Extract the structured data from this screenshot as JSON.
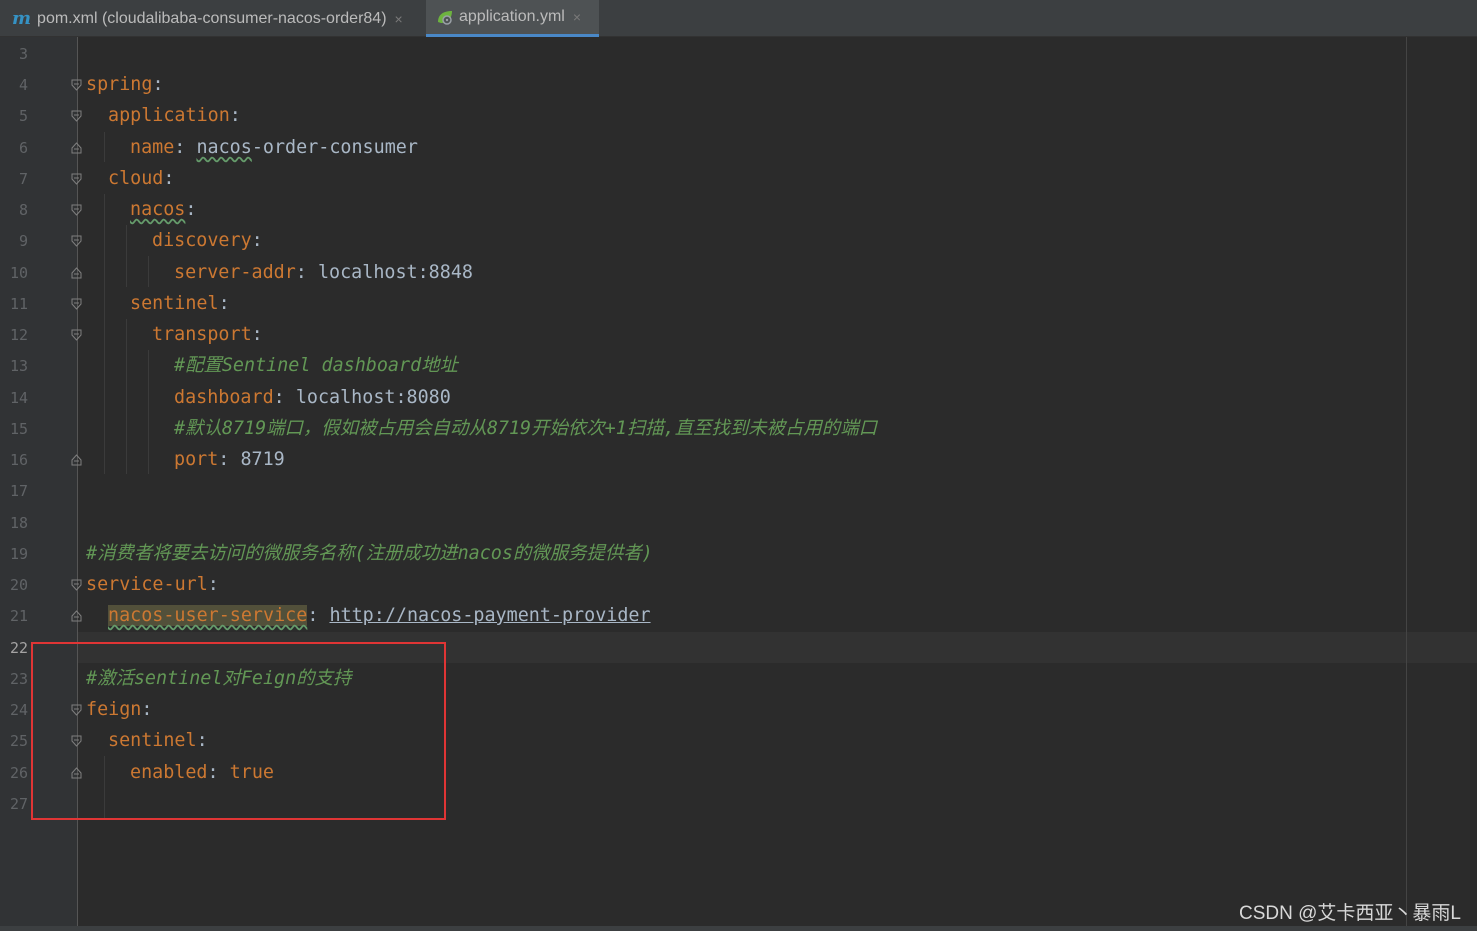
{
  "tabs": [
    {
      "icon": "maven-m-icon",
      "icon_glyph": "m",
      "label": "pom.xml (cloudalibaba-consumer-nacos-order84)",
      "close": "×",
      "active": false
    },
    {
      "icon": "spring-leaf-icon",
      "label": "application.yml",
      "close": "×",
      "active": true
    }
  ],
  "editor": {
    "line_numbers": [
      "3",
      "4",
      "5",
      "6",
      "7",
      "8",
      "9",
      "10",
      "11",
      "12",
      "13",
      "14",
      "15",
      "16",
      "17",
      "18",
      "19",
      "20",
      "21",
      "22",
      "23",
      "24",
      "25",
      "26",
      "27"
    ],
    "current_line": "22",
    "lines": {
      "l4": {
        "key": "spring",
        "colon": ":"
      },
      "l5": {
        "key": "application",
        "colon": ":"
      },
      "l6": {
        "key": "name",
        "colon": ": ",
        "value_a": "nacos",
        "value_b": "-order-consumer"
      },
      "l7": {
        "key": "cloud",
        "colon": ":"
      },
      "l8": {
        "key": "nacos",
        "colon": ":"
      },
      "l9": {
        "key": "discovery",
        "colon": ":"
      },
      "l10": {
        "key": "server-addr",
        "colon": ": ",
        "value": "localhost:8848"
      },
      "l11": {
        "key": "sentinel",
        "colon": ":"
      },
      "l12": {
        "key": "transport",
        "colon": ":"
      },
      "l13": {
        "comment": "#配置Sentinel dashboard地址"
      },
      "l14": {
        "key": "dashboard",
        "colon": ": ",
        "value": "localhost:8080"
      },
      "l15": {
        "comment": "#默认8719端口，假如被占用会自动从8719开始依次+1扫描,直至找到未被占用的端口"
      },
      "l16": {
        "key": "port",
        "colon": ": ",
        "value": "8719"
      },
      "l19": {
        "comment": "#消费者将要去访问的微服务名称(注册成功进nacos的微服务提供者)"
      },
      "l20": {
        "key": "service-url",
        "colon": ":"
      },
      "l21": {
        "key": "nacos-user-service",
        "colon": ": ",
        "value": "http://nacos-payment-provider"
      },
      "l23": {
        "comment": "#激活sentinel对Feign的支持"
      },
      "l24": {
        "key": "feign",
        "colon": ":"
      },
      "l25": {
        "key": "sentinel",
        "colon": ":"
      },
      "l26": {
        "key": "enabled",
        "colon": ": ",
        "value": "true"
      }
    }
  },
  "watermark": "CSDN @艾卡西亚丶暴雨L",
  "colors": {
    "background": "#2b2b2b",
    "gutter": "#313335",
    "key": "#cc7832",
    "comment": "#629755",
    "text": "#a9b7c6",
    "highlight_box": "#e03535",
    "active_tab_underline": "#4a88c7"
  }
}
